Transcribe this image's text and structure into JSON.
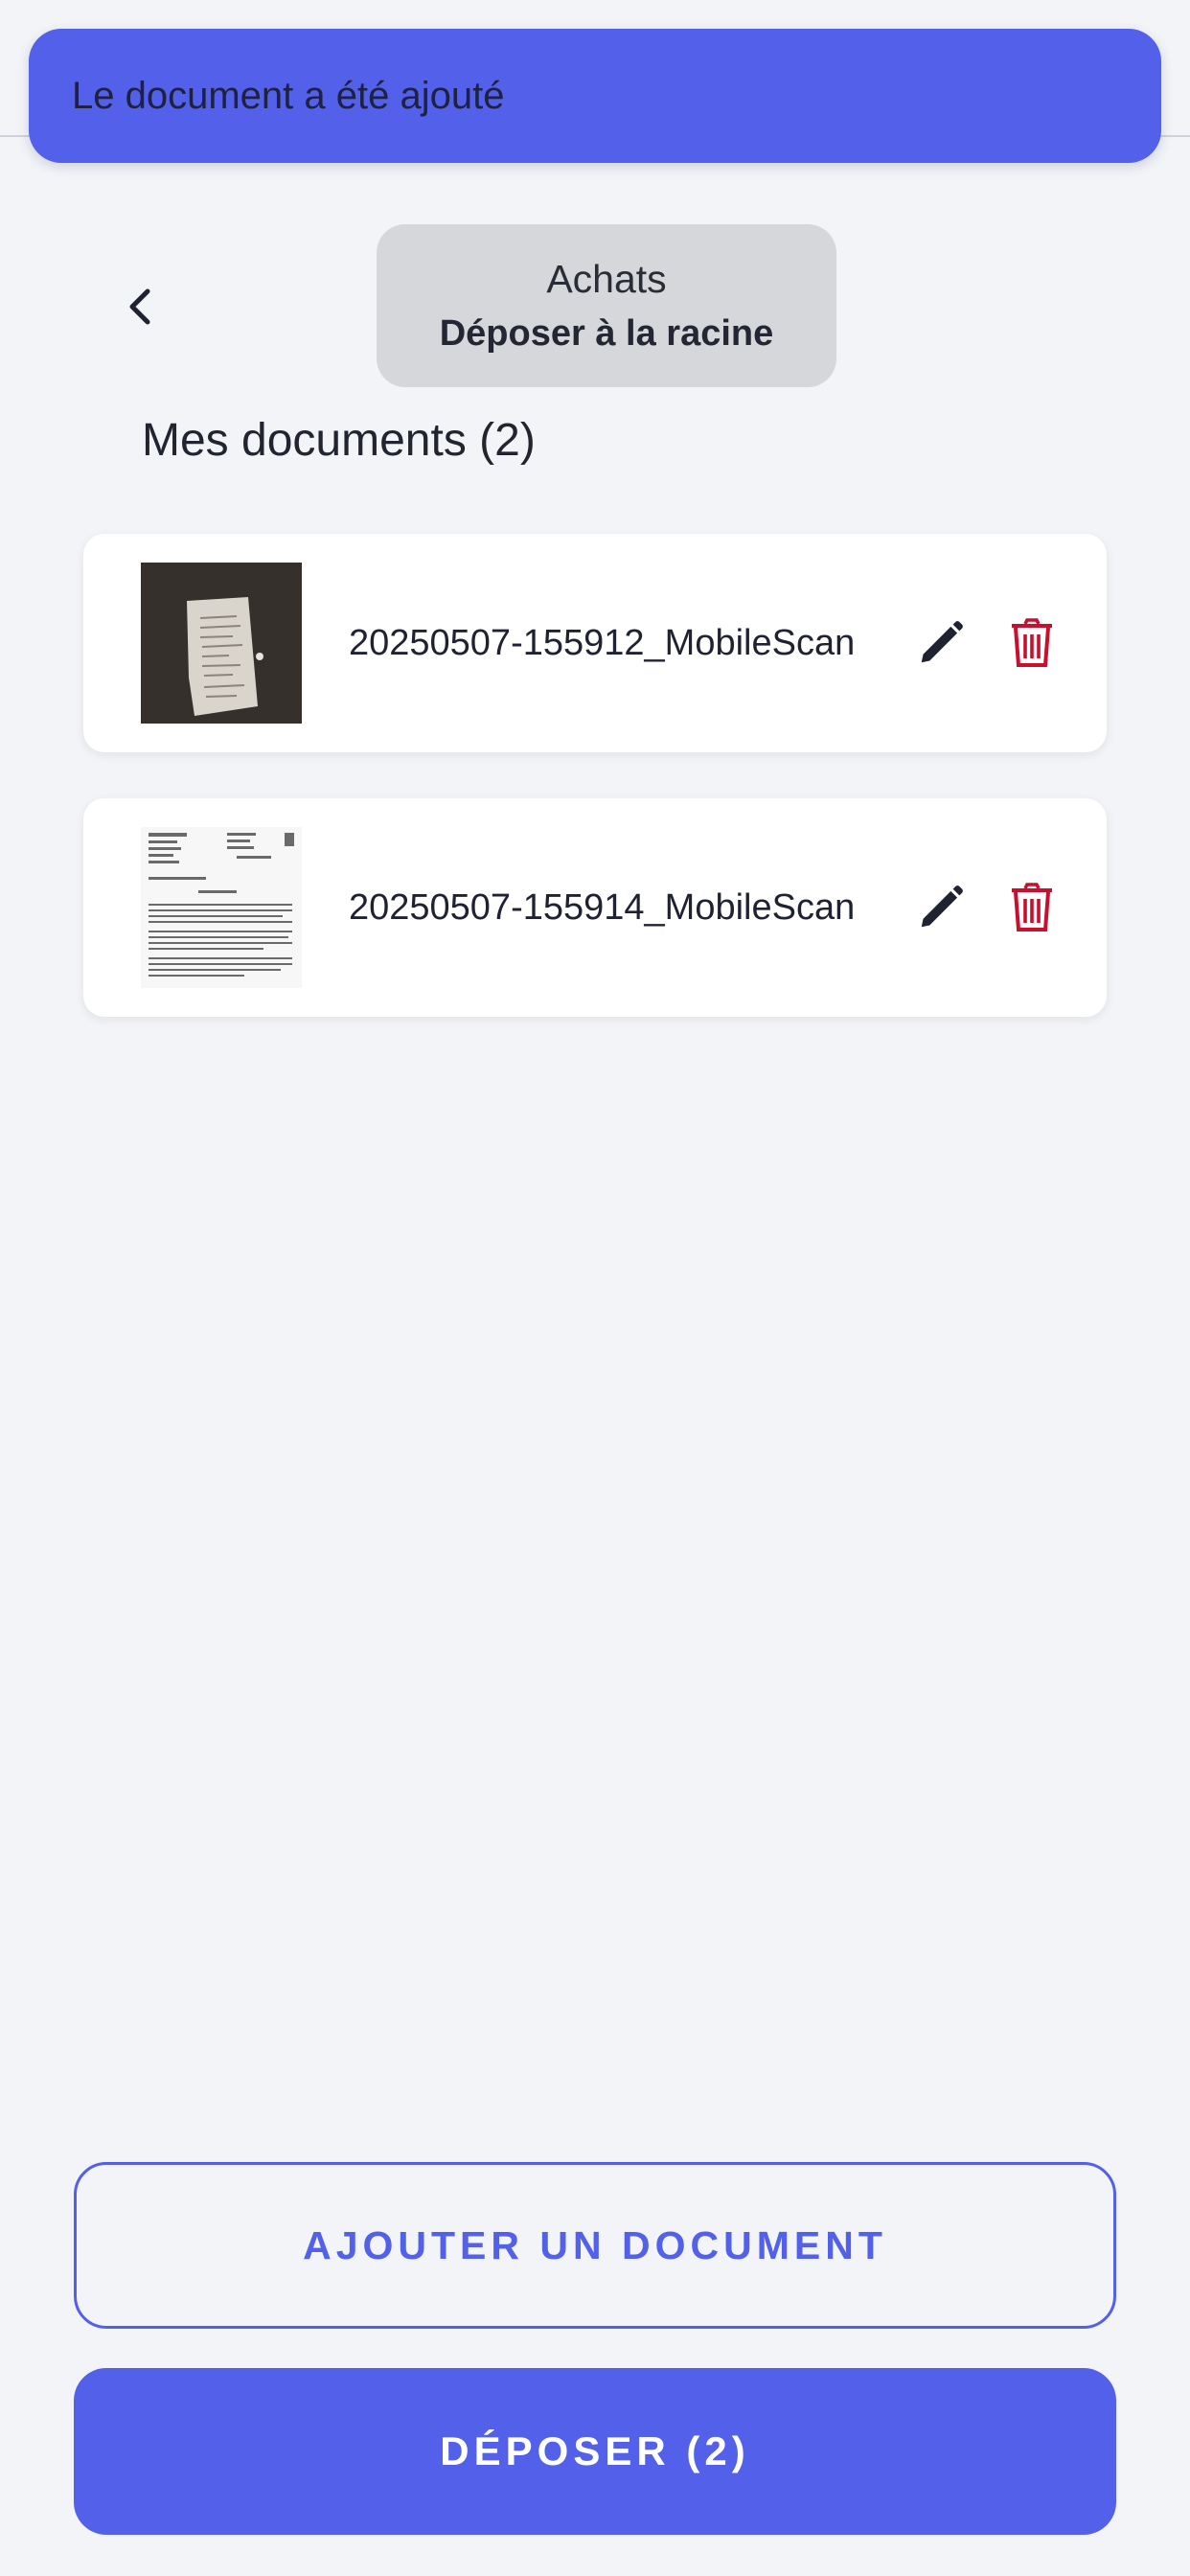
{
  "toast": {
    "message": "Le document a été ajouté"
  },
  "header": {
    "folder_name": "Achats",
    "folder_action": "Déposer à la racine"
  },
  "documents": {
    "title": "Mes documents (2)",
    "items": [
      {
        "name": "20250507-155912_MobileScan"
      },
      {
        "name": "20250507-155914_MobileScan"
      }
    ]
  },
  "actions": {
    "add_label": "AJOUTER UN DOCUMENT",
    "submit_label": "DÉPOSER (2)"
  },
  "colors": {
    "accent": "#5260ea",
    "delete": "#c8102e",
    "background": "#f3f4f7"
  },
  "icons": {
    "back": "chevron-left-icon",
    "edit": "pencil-icon",
    "delete": "trash-icon"
  }
}
